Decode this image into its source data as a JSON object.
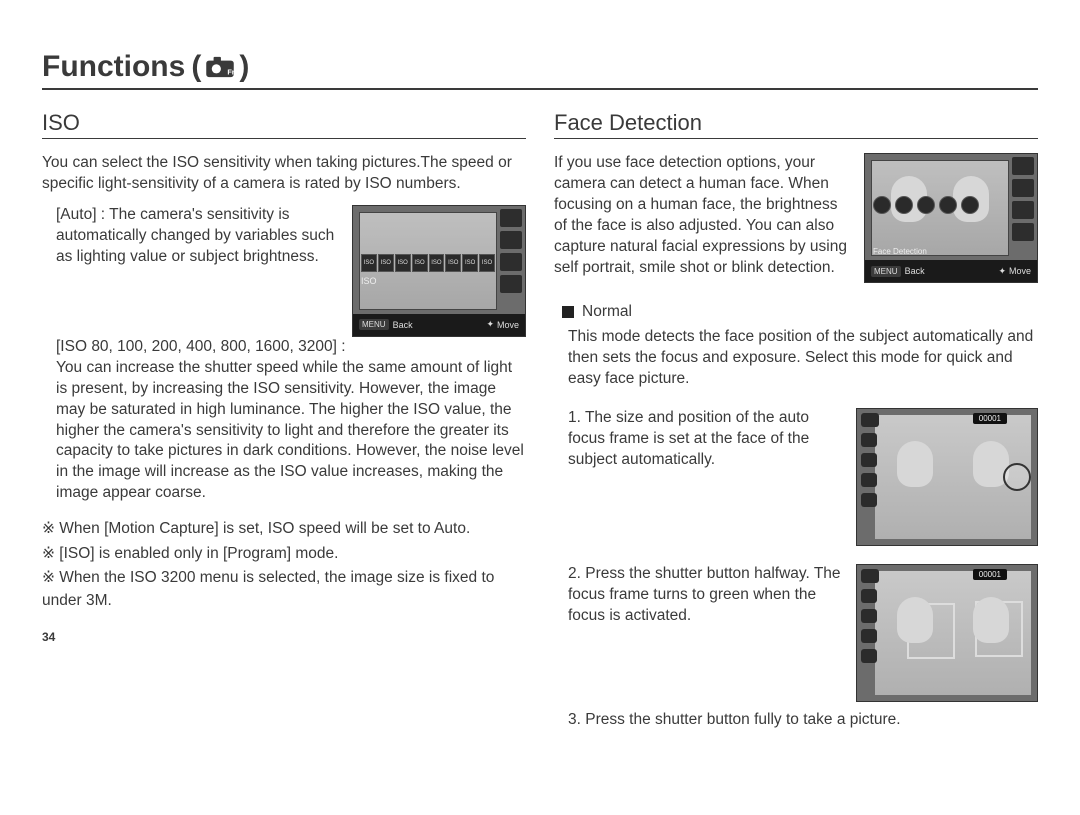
{
  "header": {
    "title": "Functions",
    "paren_open": "(",
    "paren_close": ")"
  },
  "page_number": "34",
  "iso": {
    "title": "ISO",
    "intro": "You can select the ISO sensitivity when taking pictures.The speed or specific light-sensitivity of a camera is rated by ISO numbers.",
    "auto_label": "[Auto] :",
    "auto_text": "The camera's sensitivity is automatically changed by variables such as lighting value or subject brightness.",
    "range_label": "[ISO 80, 100, 200, 400, 800, 1600, 3200] :",
    "range_text": "You can increase the shutter speed while the same amount of light is present, by increasing the ISO sensitivity. However, the image may be saturated in high luminance. The higher the ISO value, the higher the camera's sensitivity to light and therefore the greater its capacity to take pictures in dark conditions. However, the noise level in the image will increase as the ISO value increases, making the image appear coarse.",
    "notes": [
      "When [Motion Capture] is set, ISO speed will be set to Auto.",
      "[ISO] is enabled only in [Program] mode.",
      "When the ISO 3200 menu is selected, the image size is fixed to under 3M."
    ],
    "note_prefix": "※ ",
    "thumb": {
      "iso_values": [
        "ISO",
        "ISO",
        "ISO",
        "ISO",
        "ISO",
        "ISO",
        "ISO",
        "ISO"
      ],
      "iso_label": "ISO",
      "menu": "MENU",
      "back": "Back",
      "move": "Move"
    }
  },
  "face": {
    "title": "Face Detection",
    "intro": "If you use face detection options, your camera can detect a human face. When focusing on a human face, the brightness of the face is also adjusted. You can also capture natural facial expressions by using self portrait, smile shot or blink detection.",
    "normal_label": "Normal",
    "normal_text": "This mode detects the face position of the subject automatically and then sets the focus and exposure. Select this mode for quick and easy face picture.",
    "steps": [
      "1. The size and position of the auto focus frame is set at the face of the subject automatically.",
      "2. Press the shutter button halfway. The focus frame turns to green when the focus is activated.",
      "3. Press the shutter button fully to take a picture."
    ],
    "thumb_small": {
      "fd_label": "Face Detection",
      "menu": "MENU",
      "back": "Back",
      "move": "Move"
    },
    "thumb_big": {
      "counter": "00001"
    }
  }
}
